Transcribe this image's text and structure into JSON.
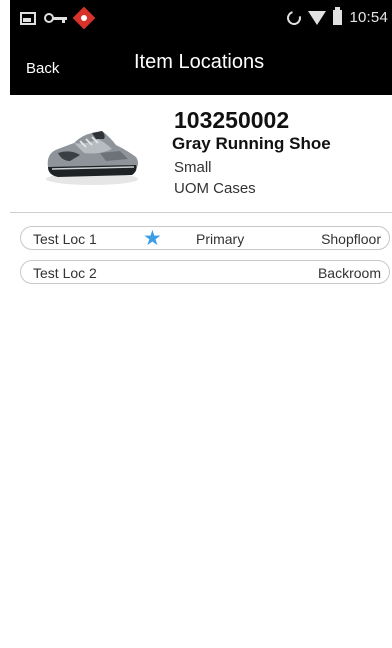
{
  "status_bar": {
    "time": "10:54",
    "icons": [
      "image-icon",
      "key-icon",
      "alert-icon",
      "rotate-icon",
      "wifi-icon",
      "battery-icon"
    ]
  },
  "app_bar": {
    "back_label": "Back",
    "title": "Item Locations"
  },
  "item": {
    "number": "103250002",
    "description": "Gray Running Shoe",
    "size": "Small",
    "uom": "UOM Cases",
    "image": "running-shoe-image"
  },
  "locations": [
    {
      "name": "Test Loc 1",
      "star": "★",
      "primary_label": "Primary",
      "zone": "Shopfloor"
    },
    {
      "name": "Test Loc 2",
      "star": "",
      "primary_label": "",
      "zone": "Backroom"
    }
  ],
  "colors": {
    "bar_background": "#000000",
    "star_blue": "#3b9de6",
    "alert_red": "#d8322a"
  }
}
